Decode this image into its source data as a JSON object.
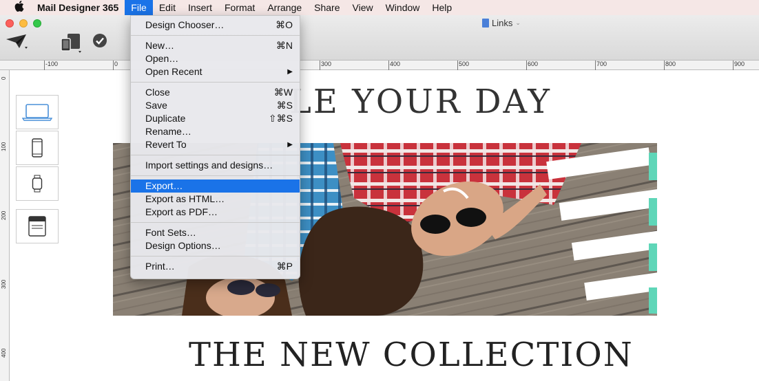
{
  "menubar": {
    "apple": "",
    "app_name": "Mail Designer 365",
    "items": [
      "File",
      "Edit",
      "Insert",
      "Format",
      "Arrange",
      "Share",
      "View",
      "Window",
      "Help"
    ]
  },
  "window": {
    "document_title": "Links"
  },
  "ruler": {
    "labels": [
      "-100",
      "0",
      "300",
      "400",
      "500",
      "600",
      "700",
      "800",
      "900"
    ],
    "vlabels": [
      "0",
      "100",
      "200",
      "300",
      "400"
    ]
  },
  "canvas": {
    "hero_title": "LE YOUR DAY",
    "collection_title": "THE NEW COLLECTION"
  },
  "file_menu": {
    "design_chooser": "Design Chooser…",
    "design_chooser_sc": "⌘O",
    "new": "New…",
    "new_sc": "⌘N",
    "open": "Open…",
    "open_recent": "Open Recent",
    "close": "Close",
    "close_sc": "⌘W",
    "save": "Save",
    "save_sc": "⌘S",
    "duplicate": "Duplicate",
    "duplicate_sc": "⇧⌘S",
    "rename": "Rename…",
    "revert_to": "Revert To",
    "import": "Import settings and designs…",
    "export": "Export…",
    "export_html": "Export as HTML…",
    "export_pdf": "Export as PDF…",
    "font_sets": "Font Sets…",
    "design_options": "Design Options…",
    "print": "Print…",
    "print_sc": "⌘P"
  },
  "colors": {
    "menubar_bg": "#f5e7e6",
    "highlight": "#1a73e8",
    "accent_teal": "#5fd6b8",
    "device_icon": "#4a90d9"
  }
}
